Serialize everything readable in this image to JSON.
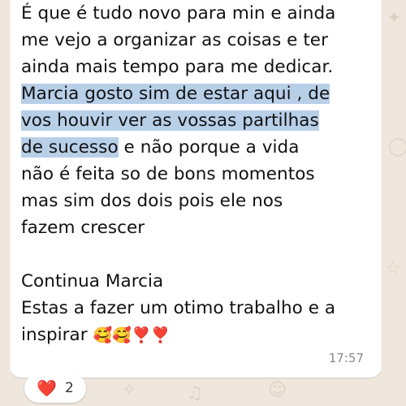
{
  "message": {
    "lines": [
      "É que é tudo novo para min e ainda",
      "me vejo a organizar as coisas e ter",
      "ainda mais tempo para me dedicar.",
      "Marcia gosto sim de estar aqui , de",
      "vos houvir ver as vossas partilhas",
      "de sucesso",
      " e não porque a vida",
      "não é feita so de bons momentos",
      "mas sim dos dois pois ele nos",
      "fazem crescer",
      "Continua Marcia",
      "Estas a fazer um otimo trabalho e a",
      "inspirar",
      "🥰🥰❣️❣️"
    ],
    "time": "17:57"
  },
  "reaction": {
    "emoji": "❤️",
    "icon": "heart-icon",
    "count": "2",
    "color": "#e0242e"
  },
  "colors": {
    "background": "#efe7dd",
    "bubble": "#ffffff",
    "highlight": "#b8cfe8"
  }
}
